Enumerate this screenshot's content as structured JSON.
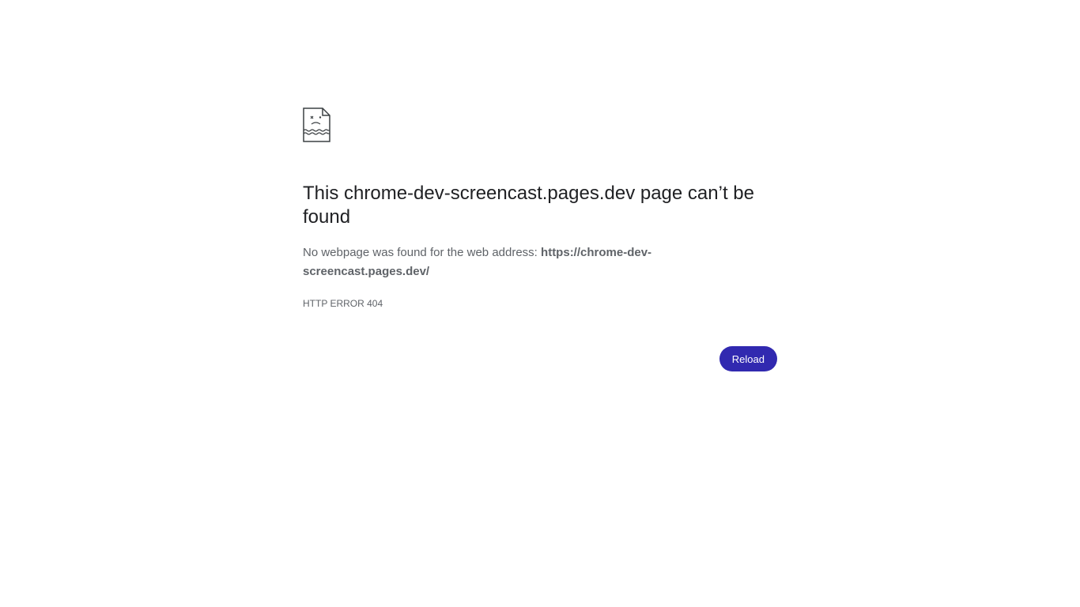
{
  "icon": "sad-page-icon",
  "heading": "This chrome-dev-screencast.pages.dev page can’t be found",
  "message": {
    "prefix": "No webpage was found for the web address: ",
    "url": "https://chrome-dev-screencast.pages.dev/"
  },
  "error_code": "HTTP ERROR 404",
  "reload_label": "Reload",
  "colors": {
    "button": "#3129b0",
    "heading": "#202124",
    "text": "#5f6368"
  }
}
